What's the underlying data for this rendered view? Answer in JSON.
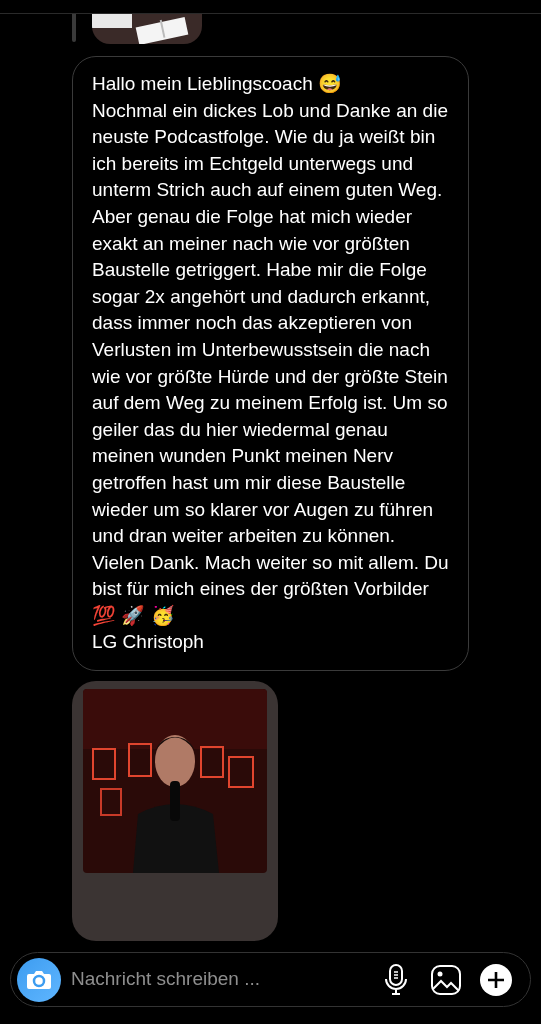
{
  "message": {
    "lines": [
      "Hallo mein Lieblingscoach 😅",
      "Nochmal ein dickes Lob und Danke an die neuste Podcastfolge. Wie du ja weißt bin ich bereits im Echtgeld unterwegs und unterm Strich auch auf einem guten Weg. Aber genau die Folge hat mich wieder exakt an meiner nach wie vor größten Baustelle getriggert. Habe mir die Folge sogar 2x angehört und dadurch erkannt, dass immer noch das akzeptieren von Verlusten im Unterbewusstsein die nach wie vor größte Hürde und der größte Stein auf dem Weg zu meinem Erfolg ist. Um so geiler das du hier wiedermal genau meinen wunden Punkt meinen Nerv getroffen hast um mir diese Baustelle wieder um so klarer vor Augen zu führen und dran weiter arbeiten zu können. Vielen Dank. Mach weiter so mit allem. Du bist für mich eines der größten Vorbilder 💯 🚀 🥳",
      "LG Christoph"
    ]
  },
  "composer": {
    "placeholder": "Nachricht schreiben ..."
  }
}
